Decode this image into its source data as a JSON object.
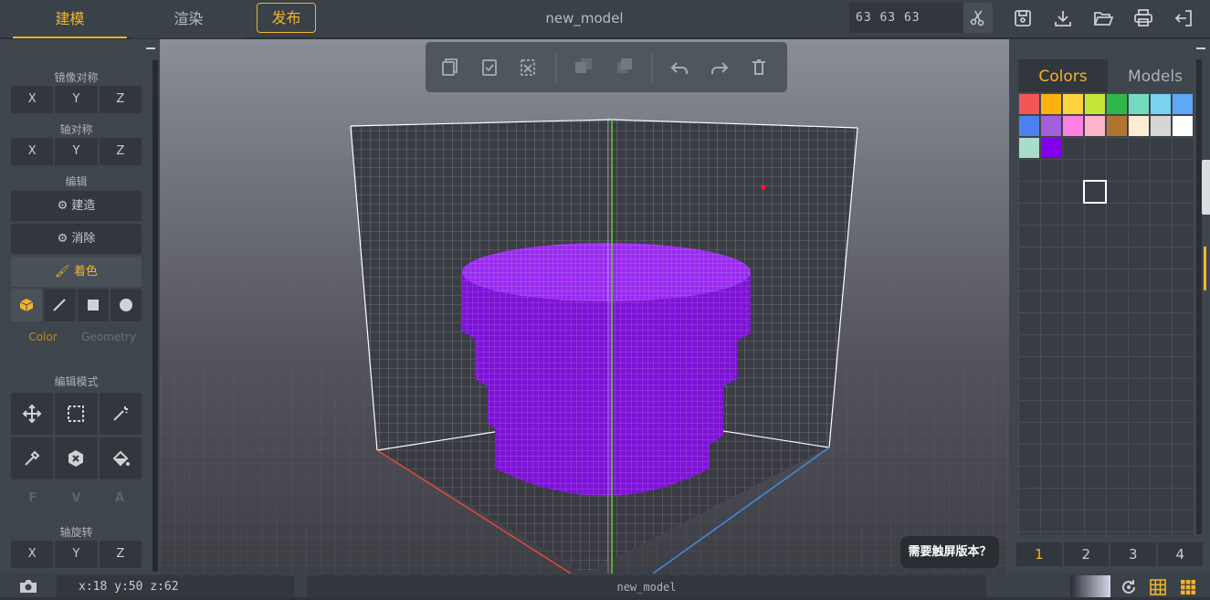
{
  "topbar": {
    "tabs": [
      {
        "label": "建模",
        "active": true
      },
      {
        "label": "渲染",
        "active": false
      }
    ],
    "publish_label": "发布",
    "title": "new_model",
    "dimensions": "63 63 63",
    "icons": [
      "scissors-icon",
      "save-icon",
      "download-icon",
      "folder-open-icon",
      "print-icon",
      "exit-icon"
    ]
  },
  "left": {
    "mirror_title": "镜像对称",
    "mirror_axes": [
      "X",
      "Y",
      "Z"
    ],
    "axis_title": "轴对称",
    "axis_axes": [
      "X",
      "Y",
      "Z"
    ],
    "edit_title": "编辑",
    "build_label": "建造",
    "erase_label": "消除",
    "paint_label": "着色",
    "color_tab": "Color",
    "geometry_tab": "Geometry",
    "edit_mode_title": "编辑模式",
    "fva": [
      "F",
      "V",
      "A"
    ],
    "rotate_title": "轴旋转",
    "rotate_axes": [
      "X",
      "Y",
      "Z"
    ]
  },
  "right": {
    "tabs": [
      "Colors",
      "Models"
    ],
    "pages": [
      "1",
      "2",
      "3",
      "4"
    ],
    "swatches": [
      "#f25757",
      "#ffb20f",
      "#ffd23f",
      "#c4e63a",
      "#2eb84a",
      "#72dcc1",
      "#79d2f0",
      "#5fa8f5",
      "#4d7ff0",
      "#a45fdc",
      "#ff80e5",
      "#ffb3c8",
      "#b07432",
      "#fdebd3",
      "#d6d6d6",
      "#ffffff",
      "#a9dccb",
      "#8400e8"
    ]
  },
  "toast": "需要触屏版本？",
  "status": {
    "coords": "x:18  y:50  z:62",
    "model_name": "new_model"
  },
  "colors": {
    "accent": "#f0b429",
    "voxel": "#8a14e6"
  }
}
